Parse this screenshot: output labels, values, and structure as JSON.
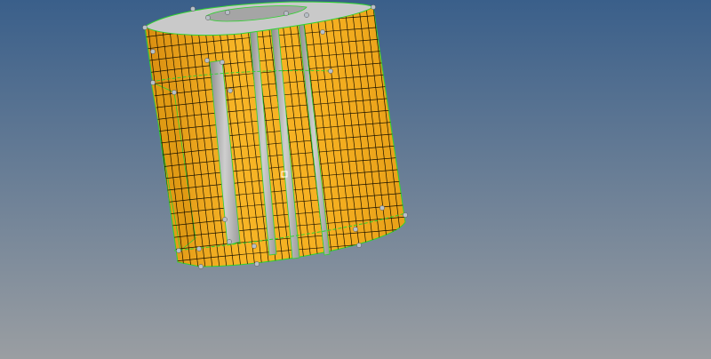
{
  "viewport": {
    "status_text": "",
    "background_top": "#3a5f8a",
    "background_bottom": "#9a9ea2"
  },
  "model": {
    "mesh_color": "#f5b021",
    "mesh_shade_color": "#e89d12",
    "edge_color": "#2fd22f",
    "slot_color": "#a8a8a8",
    "cap_color": "#c9c9c9",
    "node_color": "#b8c0c8",
    "grid_line_color": "#1a1200"
  },
  "icons": {
    "center_marker": "crosshair-icon"
  }
}
